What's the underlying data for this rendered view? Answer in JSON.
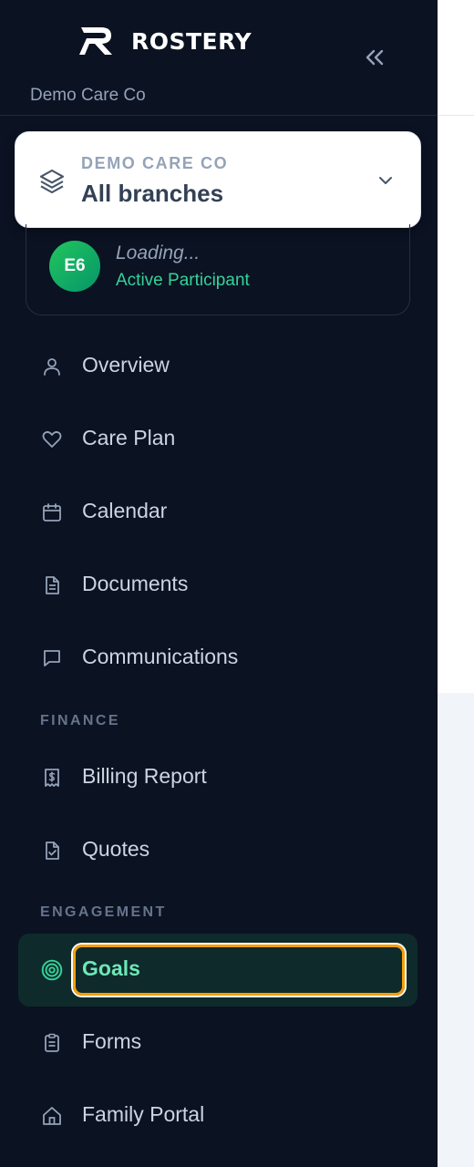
{
  "app": {
    "name": "ROSTERY",
    "org_subtitle": "Demo Care Co"
  },
  "branch_selector": {
    "eyebrow": "DEMO CARE CO",
    "title": "All branches"
  },
  "participant": {
    "initials": "E6",
    "name": "Loading...",
    "status": "Active Participant"
  },
  "nav": {
    "main": [
      {
        "label": "Overview",
        "icon": "user-icon"
      },
      {
        "label": "Care Plan",
        "icon": "heart-icon"
      },
      {
        "label": "Calendar",
        "icon": "calendar-icon"
      },
      {
        "label": "Documents",
        "icon": "document-icon"
      },
      {
        "label": "Communications",
        "icon": "message-icon"
      }
    ],
    "finance_label": "FINANCE",
    "finance": [
      {
        "label": "Billing Report",
        "icon": "receipt-dollar-icon"
      },
      {
        "label": "Quotes",
        "icon": "file-check-icon"
      }
    ],
    "engagement_label": "ENGAGEMENT",
    "engagement": [
      {
        "label": "Goals",
        "icon": "target-icon",
        "active": true
      },
      {
        "label": "Forms",
        "icon": "clipboard-icon"
      },
      {
        "label": "Family Portal",
        "icon": "home-icon"
      }
    ]
  },
  "colors": {
    "sidebar_bg": "#0b1222",
    "accent_green": "#34d399",
    "focus_ring": "#f59e0b",
    "active_bg": "#0f2a2b"
  }
}
